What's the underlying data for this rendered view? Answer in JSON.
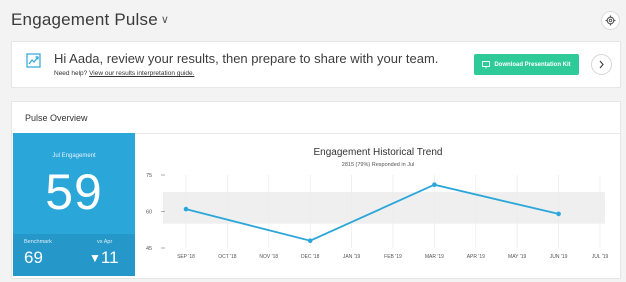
{
  "header": {
    "title": "Engagement Pulse"
  },
  "banner": {
    "message": "Hi Aada, review your results, then prepare to share with your team.",
    "help_prefix": "Need help?",
    "help_link": "View our results interpretation guide.",
    "download_label": "Download Presentation Kit"
  },
  "panel": {
    "title": "Pulse Overview",
    "kpi": {
      "label": "Jul Engagement",
      "score": "59",
      "benchmark_label": "Benchmark",
      "benchmark_value": "69",
      "vs_label": "vs Apr",
      "vs_value": "11"
    }
  },
  "icons": {
    "settings": "gear-icon",
    "banner": "chart-growth-icon",
    "download": "present-icon",
    "next": "chevron-right-icon"
  },
  "colors": {
    "kpi_bg": "#2ba6d9",
    "line": "#2ba6d9",
    "button": "#2ecb98"
  },
  "chart_data": {
    "type": "line",
    "title": "Engagement Historical Trend",
    "subtitle": "2815 (79%) Responded in Jul",
    "categories": [
      "SEP '18",
      "OCT '18",
      "NOV '18",
      "DEC '18",
      "JAN '19",
      "FEB '19",
      "MAR '19",
      "APR '19",
      "MAY '19",
      "JUN '19",
      "JUL '19"
    ],
    "y_ticks": [
      45,
      60,
      75
    ],
    "ylim": [
      45,
      75
    ],
    "band": [
      55,
      68
    ],
    "points": [
      {
        "x": "SEP '18",
        "y": 61
      },
      {
        "x": "DEC '18",
        "y": 48
      },
      {
        "x": "MAR '19",
        "y": 71
      },
      {
        "x": "JUN '19",
        "y": 59
      }
    ],
    "grid": true
  }
}
